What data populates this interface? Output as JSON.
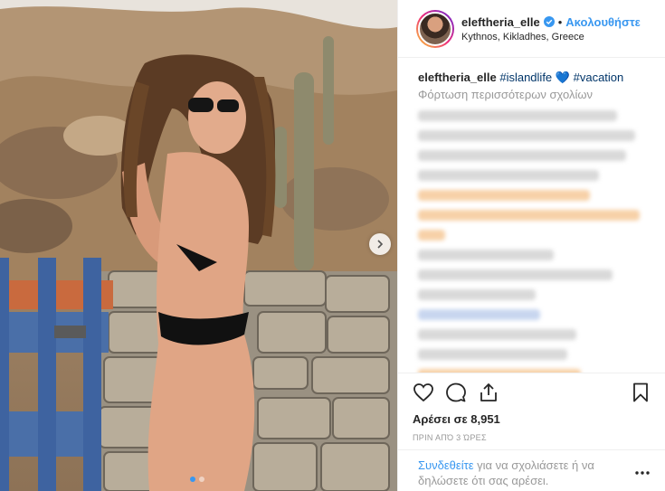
{
  "post": {
    "username": "eleftheria_elle",
    "separator": "•",
    "follow_label": "Ακολουθήστε",
    "location": "Kythnos, Kikladhes, Greece"
  },
  "caption": {
    "username": "eleftheria_elle",
    "tag1": "#islandlife",
    "emoji": "💙",
    "tag2": "#vacation"
  },
  "load_more": "Φόρτωση περισσότερων σχολίων",
  "likes": "Αρέσει σε 8,951",
  "time": "ΠΡΙΝ ΑΠΌ 3 ΏΡΕΣ",
  "login_prompt": {
    "link": "Συνδεθείτε",
    "text": " για να σχολιάσετε ή να δηλώσετε ότι σας αρέσει."
  },
  "carousel": {
    "count": 2,
    "active": 1
  },
  "icons": {
    "like": "heart-icon",
    "comment": "comment-icon",
    "share": "share-icon",
    "save": "bookmark-icon",
    "more": "more-options-icon",
    "next": "chevron-right-icon",
    "verified": "verified-badge-icon"
  },
  "colors": {
    "link": "#3897f0",
    "hashtag": "#003569",
    "muted": "#999999",
    "text": "#262626"
  }
}
